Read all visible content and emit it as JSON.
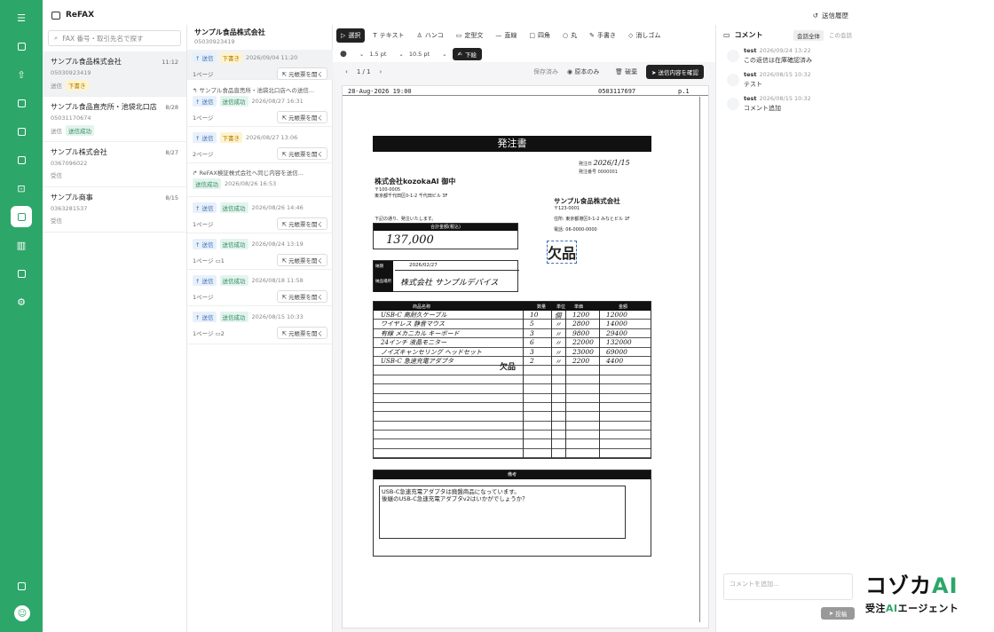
{
  "app": {
    "title": "ReFAX",
    "history_label": "送信履歴"
  },
  "search": {
    "placeholder": "FAX 番号・取引先名で探す"
  },
  "conversations": [
    {
      "name": "サンプル食品株式会社",
      "phone": "05030923419",
      "time": "11:12",
      "meta": "送信",
      "tag": "下書き"
    },
    {
      "name": "サンプル食品直売所・池袋北口店",
      "phone": "05031170674",
      "time": "8/28",
      "meta": "送信",
      "tag": "送信成功"
    },
    {
      "name": "サンプル株式会社",
      "phone": "0367096022",
      "time": "8/27",
      "meta": "受信",
      "tag": ""
    },
    {
      "name": "サンプル商事",
      "phone": "0363281537",
      "time": "8/15",
      "meta": "受信",
      "tag": ""
    }
  ],
  "thread": {
    "name": "サンプル食品株式会社",
    "phone": "05030923419",
    "messages": [
      {
        "dir": "↑ 送信",
        "tag": "下書き",
        "date": "2026/09/04 11:20",
        "pages": "1ページ",
        "comments": "",
        "open": "元帳票を開く",
        "forward": ""
      },
      {
        "dir": "↑ 送信",
        "tag": "送信成功",
        "date": "2026/08/27 16:31",
        "pages": "1ページ",
        "comments": "",
        "open": "元帳票を開く",
        "forward": "サンプル食品直売所・池袋北口店への送信..."
      },
      {
        "dir": "↑ 送信",
        "tag": "下書き",
        "date": "2026/08/27 13:06",
        "pages": "2ページ",
        "comments": "",
        "open": "元帳票を開く",
        "forward": ""
      },
      {
        "dir": "",
        "tag": "送信成功",
        "date": "2026/08/26 16:53",
        "pages": "",
        "comments": "",
        "open": "",
        "forward": "ReFAX検証株式会社へ同じ内容を送信..."
      },
      {
        "dir": "↑ 送信",
        "tag": "送信成功",
        "date": "2026/08/26 14:46",
        "pages": "1ページ",
        "comments": "",
        "open": "元帳票を開く",
        "forward": ""
      },
      {
        "dir": "↑ 送信",
        "tag": "送信成功",
        "date": "2026/08/24 13:19",
        "pages": "1ページ",
        "comments": "1",
        "open": "元帳票を開く",
        "forward": ""
      },
      {
        "dir": "↑ 送信",
        "tag": "送信成功",
        "date": "2026/08/18 11:58",
        "pages": "1ページ",
        "comments": "",
        "open": "元帳票を開く",
        "forward": ""
      },
      {
        "dir": "↑ 送信",
        "tag": "送信成功",
        "date": "2026/08/15 10:33",
        "pages": "1ページ",
        "comments": "2",
        "open": "元帳票を開く",
        "forward": ""
      }
    ]
  },
  "toolbar": {
    "tools": [
      "選択",
      "テキスト",
      "ハンコ",
      "定型文",
      "直線",
      "四角",
      "丸",
      "手書き",
      "消しゴム"
    ],
    "stroke": "1.5 pt",
    "font": "10.5 pt",
    "draft_button": "下絵",
    "page_indicator": "1 / 1",
    "saved": "保存済み",
    "original_only": "原本のみ",
    "discard": "破棄",
    "confirm_send": "送信内容を確認"
  },
  "fax": {
    "header_date": "28-Aug-2026 19:00",
    "header_number": "0503117697",
    "header_page": "p.1",
    "doc_title": "発注書",
    "issue_date_label": "発注日",
    "issue_date": "2026/1/15",
    "order_no_label": "発注番号",
    "order_no": "0000001",
    "recipient": "株式会社kozokaAI 御中",
    "recipient_zip": "〒100-0005",
    "recipient_addr": "東京都千代田区0-1-2 千代田ビル 3F",
    "sender": "サンプル食品株式会社",
    "sender_zip": "〒123-0001",
    "sender_addr_label": "住所:",
    "sender_addr": "東京都港区0-1-2 みなとビル 1F",
    "sender_tel_label": "電話:",
    "sender_tel": "06-0000-0000",
    "greeting": "下記の通り、発注いたします。",
    "total_label": "合計金額(税込)",
    "total": "137,000",
    "shortage": "欠品",
    "deadline_label": "納期",
    "deadline": "2026/02/27",
    "delivery_label": "納品場所",
    "delivery": "株式会社 サンプルデバイス",
    "columns": [
      "商品名称",
      "数量",
      "単位",
      "単価",
      "金額"
    ],
    "rows": [
      [
        "USB-C 高耐久ケーブル",
        "10",
        "個",
        "1200",
        "12000"
      ],
      [
        "ワイヤレス 静音マウス",
        "5",
        "〃",
        "2800",
        "14000"
      ],
      [
        "有線 メカニカル キーボード",
        "3",
        "〃",
        "9800",
        "29400"
      ],
      [
        "24インチ 液晶モニター",
        "6",
        "〃",
        "22000",
        "132000"
      ],
      [
        "ノイズキャンセリング ヘッドセット",
        "3",
        "〃",
        "23000",
        "69000"
      ],
      [
        "USB-C 急速充電アダプタ",
        "2",
        "〃",
        "2200",
        "4400"
      ]
    ],
    "remarks_label": "備考",
    "remarks_line1": "USB-C急速充電アダプタは廃盤商品になっています。",
    "remarks_line2": "後継のUSB-C急速充電アダプタv2はいかがでしょうか？"
  },
  "comments": {
    "title": "コメント",
    "scope_all": "会話全体",
    "scope_this": "この会話",
    "items": [
      {
        "user": "test",
        "time": "2026/09/24 13:22",
        "text": "この返信は在庫確認済み"
      },
      {
        "user": "test",
        "time": "2026/08/15 10:32",
        "text": "テスト"
      },
      {
        "user": "test",
        "time": "2026/08/15 10:32",
        "text": "コメント追加"
      }
    ],
    "input_placeholder": "コメントを追加...",
    "post_label": "投稿"
  },
  "logo": {
    "main": "コゾカ",
    "main_ai": "AI",
    "sub": "受注",
    "sub_ai": "AI",
    "sub_tail": "エージェント"
  },
  "colors": {
    "brand": "#2da66a",
    "draft_tag": "#fff3cd",
    "success_tag": "#e3f4ee"
  }
}
